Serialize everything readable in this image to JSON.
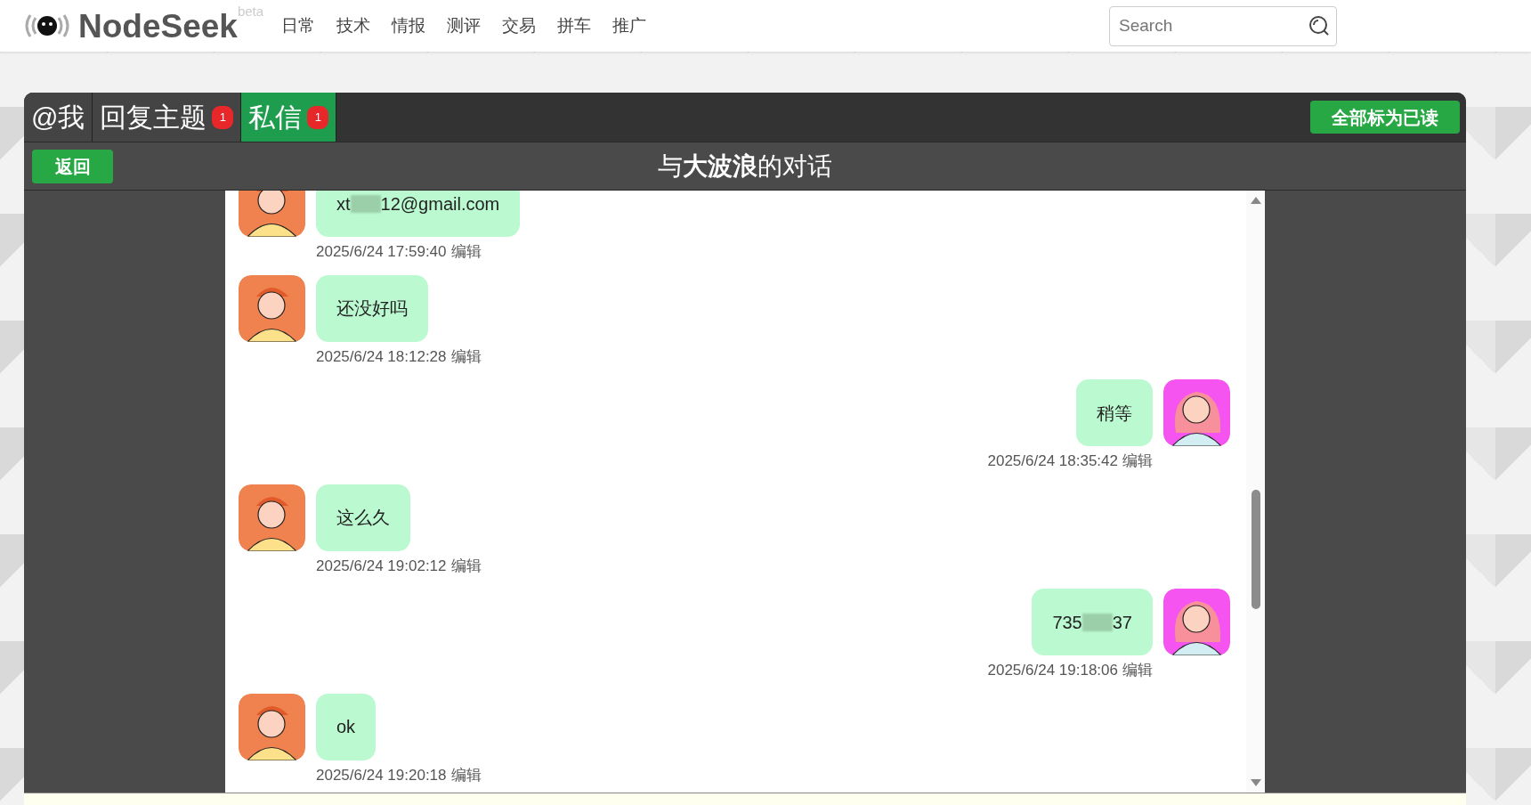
{
  "header": {
    "logo": "NodeSeek",
    "logo_tag": "beta",
    "nav": [
      "日常",
      "技术",
      "情报",
      "测评",
      "交易",
      "拼车",
      "推广"
    ],
    "search": {
      "placeholder": "Search"
    }
  },
  "tabs": [
    {
      "label": "@我",
      "selected": false
    },
    {
      "label": "回复主题",
      "badge": "1",
      "selected": false
    },
    {
      "label": "私信",
      "badge": "1",
      "selected": true
    }
  ],
  "mark_all_read": "全部标为已读",
  "back_button": "返回",
  "conversation_title": "与**大波浪**的对话",
  "messages": [
    {
      "from_me": false,
      "kind": "masked",
      "text_before_mask": "xt",
      "text_after_mask": "12@gmail.com",
      "time": "2025/6/24 17:59:40",
      "action": "编辑"
    },
    {
      "from_me": false,
      "kind": "text",
      "text": "还没好吗",
      "time": "2025/6/24 18:12:28",
      "action": "编辑"
    },
    {
      "from_me": true,
      "kind": "text",
      "text": "稍等",
      "time": "2025/6/24 18:35:42",
      "action": "编辑"
    },
    {
      "from_me": false,
      "kind": "text",
      "text": "这么久",
      "time": "2025/6/24 19:02:12",
      "action": "编辑"
    },
    {
      "from_me": true,
      "kind": "masked",
      "text_before_mask": "735",
      "text_after_mask": "37",
      "time": "2025/6/24 19:18:06",
      "action": "编辑"
    },
    {
      "from_me": false,
      "kind": "text",
      "text": "ok",
      "time": "2025/6/24 19:20:18",
      "action": "编辑"
    }
  ]
}
